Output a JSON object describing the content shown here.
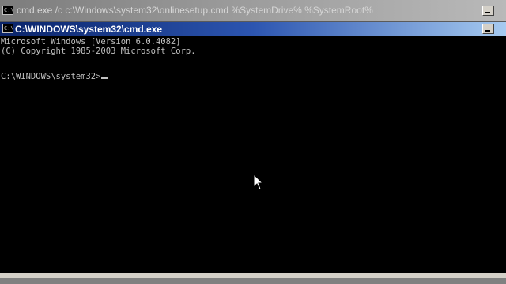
{
  "background_window": {
    "title": "cmd.exe /c c:\\Windows\\system32\\onlinesetup.cmd %SystemDrive% %SystemRoot%",
    "icon": "cmd-icon",
    "minimize_icon": "minimize-icon"
  },
  "active_window": {
    "title": "C:\\WINDOWS\\system32\\cmd.exe",
    "icon": "cmd-icon",
    "minimize_icon": "minimize-icon"
  },
  "console": {
    "line1": "Microsoft Windows [Version 6.0.4082]",
    "line2": "(C) Copyright 1985-2003 Microsoft Corp.",
    "prompt": "C:\\WINDOWS\\system32>"
  },
  "colors": {
    "console_bg": "#000000",
    "console_fg": "#c0c0c0",
    "active_title_start": "#0a246a",
    "active_title_end": "#a6caf0",
    "inactive_title": "#9a9a9a"
  }
}
